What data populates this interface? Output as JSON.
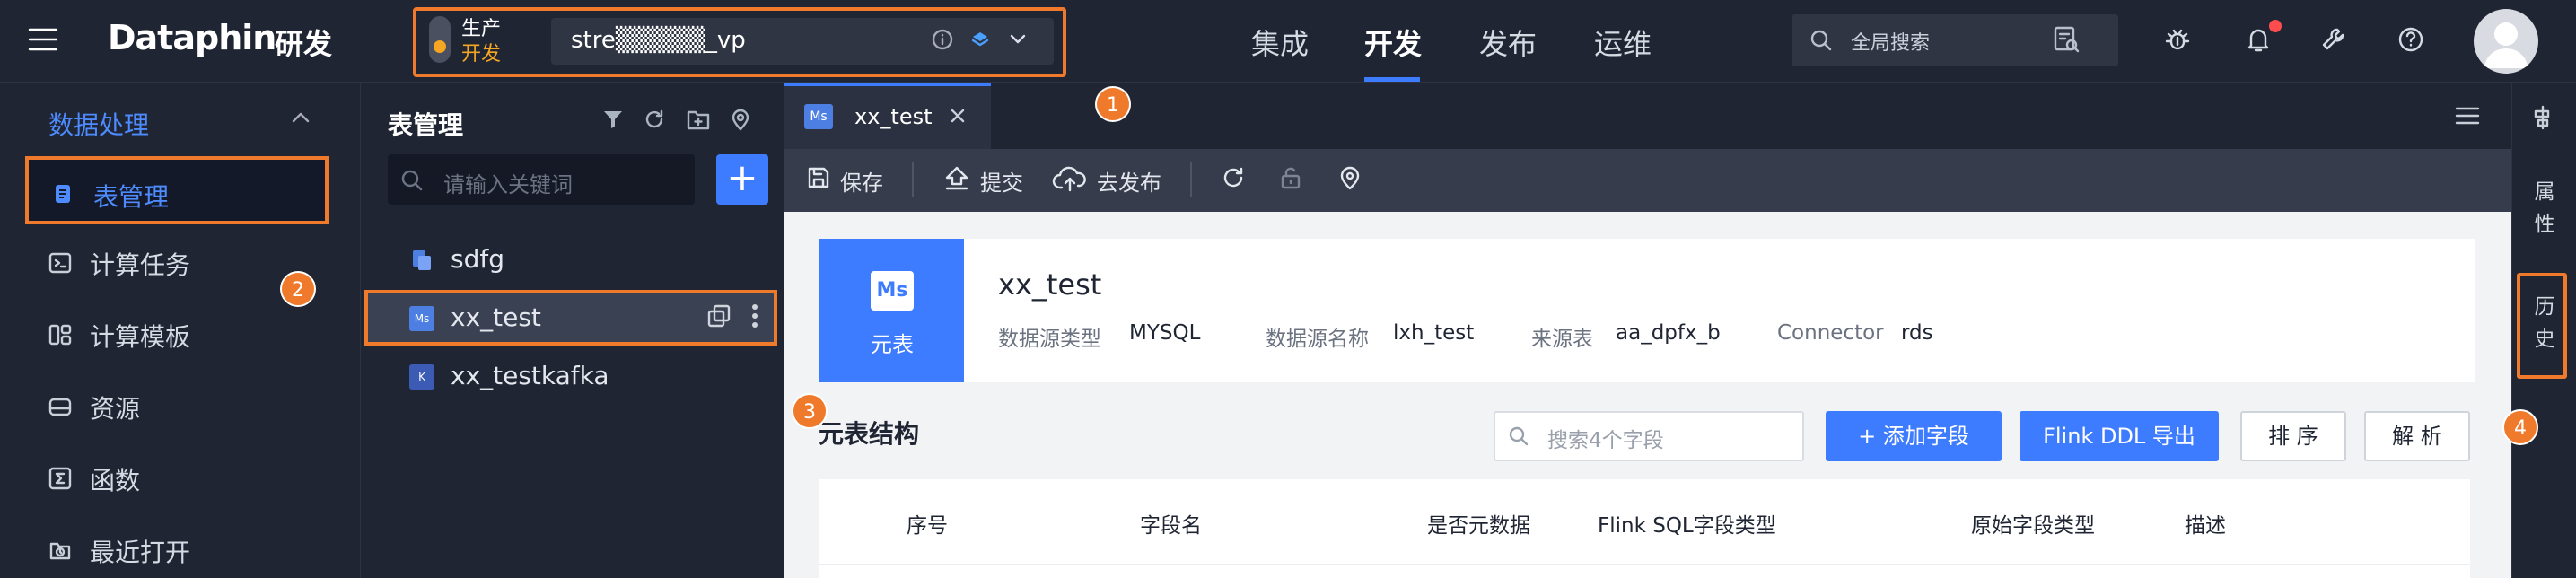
{
  "app": {
    "logo": "Dataphin",
    "module": "研发"
  },
  "env": {
    "line1": "生产",
    "line2": "开发",
    "project": "stre▒▒▒▒▒_vp"
  },
  "topnav": [
    "集成",
    "开发",
    "发布",
    "运维"
  ],
  "topnav_active": "开发",
  "global_search": {
    "placeholder": "全局搜索"
  },
  "sidebar": {
    "section": "数据处理",
    "items": [
      {
        "label": "表管理",
        "icon": "table-icon",
        "active": true
      },
      {
        "label": "计算任务",
        "icon": "terminal-icon"
      },
      {
        "label": "计算模板",
        "icon": "template-icon"
      },
      {
        "label": "资源",
        "icon": "resource-icon"
      },
      {
        "label": "函数",
        "icon": "function-icon"
      },
      {
        "label": "最近打开",
        "icon": "recent-icon"
      }
    ]
  },
  "table_panel": {
    "title": "表管理",
    "search_placeholder": "请输入关键词",
    "add_label": "+",
    "items": [
      {
        "label": "sdfg",
        "badge": "",
        "color": "#4d7fe3"
      },
      {
        "label": "xx_test",
        "badge": "Ms",
        "color": "#4d7fe3",
        "active": true
      },
      {
        "label": "xx_testkafka",
        "badge": "K",
        "color": "#3b5bb5"
      }
    ]
  },
  "tab": {
    "label": "xx_test",
    "badge": "Ms"
  },
  "toolbar": {
    "save": "保存",
    "submit": "提交",
    "publish": "去发布"
  },
  "meta": {
    "badge": "Ms",
    "icon_label": "元表",
    "name": "xx_test",
    "fields": [
      {
        "key": "数据源类型",
        "value": "MYSQL"
      },
      {
        "key": "数据源名称",
        "value": "lxh_test"
      },
      {
        "key": "来源表",
        "value": "aa_dpfx_b"
      },
      {
        "key": "Connector",
        "value": "rds"
      }
    ]
  },
  "structure": {
    "title": "元表结构",
    "search_placeholder": "搜索4个字段",
    "add_field": "+ 添加字段",
    "flink_export": "Flink DDL 导出",
    "sort": "排 序",
    "parse": "解 析",
    "columns": [
      "序号",
      "字段名",
      "是否元数据",
      "Flink SQL字段类型",
      "原始字段类型",
      "描述"
    ]
  },
  "rail": {
    "attr": "属性",
    "history": "历史"
  },
  "markers": [
    "1",
    "2",
    "3",
    "4"
  ],
  "colors": {
    "accent": "#3d7bff",
    "highlight": "#f07a2b",
    "dark": "#1f2532"
  }
}
